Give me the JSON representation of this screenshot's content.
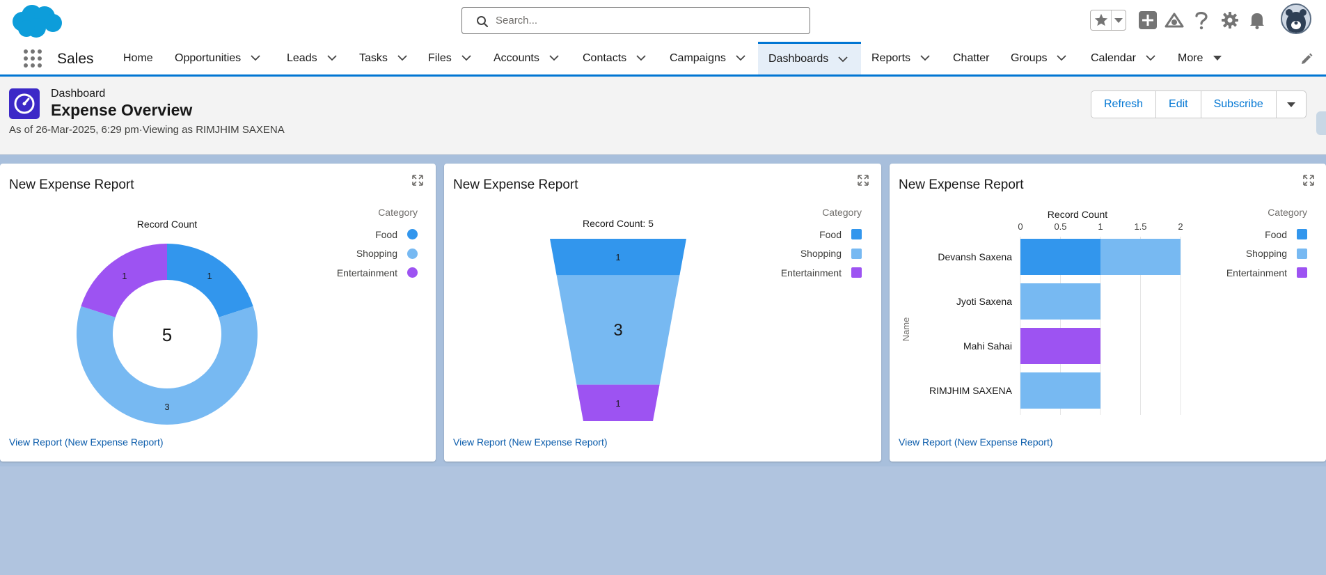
{
  "header": {
    "search_placeholder": "Search..."
  },
  "nav": {
    "app_name": "Sales",
    "items": [
      {
        "label": "Home",
        "chevron": false
      },
      {
        "label": "Opportunities",
        "chevron": true
      },
      {
        "label": "Leads",
        "chevron": true
      },
      {
        "label": "Tasks",
        "chevron": true
      },
      {
        "label": "Files",
        "chevron": true
      },
      {
        "label": "Accounts",
        "chevron": true
      },
      {
        "label": "Contacts",
        "chevron": true
      },
      {
        "label": "Campaigns",
        "chevron": true
      },
      {
        "label": "Dashboards",
        "chevron": true,
        "active": true
      },
      {
        "label": "Reports",
        "chevron": true
      },
      {
        "label": "Chatter",
        "chevron": false
      },
      {
        "label": "Groups",
        "chevron": true
      },
      {
        "label": "Calendar",
        "chevron": true
      },
      {
        "label": "More",
        "chevron": true
      }
    ]
  },
  "dashboard": {
    "type_label": "Dashboard",
    "title": "Expense Overview",
    "subtitle": "As of 26-Mar-2025, 6:29 pm·Viewing as RIMJHIM SAXENA",
    "buttons": {
      "refresh": "Refresh",
      "edit": "Edit",
      "subscribe": "Subscribe"
    }
  },
  "colors": {
    "food": "#3296ed",
    "shopping": "#77b9f2",
    "entertainment": "#9d53f2"
  },
  "legend": {
    "title": "Category",
    "items": [
      "Food",
      "Shopping",
      "Entertainment"
    ]
  },
  "panels": [
    {
      "title": "New Expense Report",
      "chart_label": "Record Count",
      "link": "View Report (New Expense Report)"
    },
    {
      "title": "New Expense Report",
      "chart_label": "Record Count: 5",
      "link": "View Report (New Expense Report)"
    },
    {
      "title": "New Expense Report",
      "chart_label": "Record Count",
      "y_axis_label": "Name",
      "link": "View Report (New Expense Report)"
    }
  ],
  "chart_data": [
    {
      "type": "pie",
      "variant": "donut",
      "title": "Record Count",
      "center_total": "5",
      "categories": [
        "Food",
        "Shopping",
        "Entertainment"
      ],
      "values": [
        1,
        3,
        1
      ]
    },
    {
      "type": "bar",
      "variant": "funnel",
      "title": "Record Count: 5",
      "categories": [
        "Food",
        "Shopping",
        "Entertainment"
      ],
      "values": [
        1,
        3,
        1
      ]
    },
    {
      "type": "bar",
      "orientation": "horizontal",
      "stacked": true,
      "xlabel": "Record Count",
      "ylabel": "Name",
      "xlim": [
        0,
        2
      ],
      "x_ticks": [
        "0",
        "0.5",
        "1",
        "1.5",
        "2"
      ],
      "categories": [
        "Devansh Saxena",
        "Jyoti Saxena",
        "Mahi Sahai",
        "RIMJHIM SAXENA"
      ],
      "series": [
        {
          "name": "Food",
          "values": [
            1,
            0,
            0,
            0
          ]
        },
        {
          "name": "Shopping",
          "values": [
            1,
            1,
            0,
            1
          ]
        },
        {
          "name": "Entertainment",
          "values": [
            0,
            0,
            1,
            0
          ]
        }
      ]
    }
  ]
}
